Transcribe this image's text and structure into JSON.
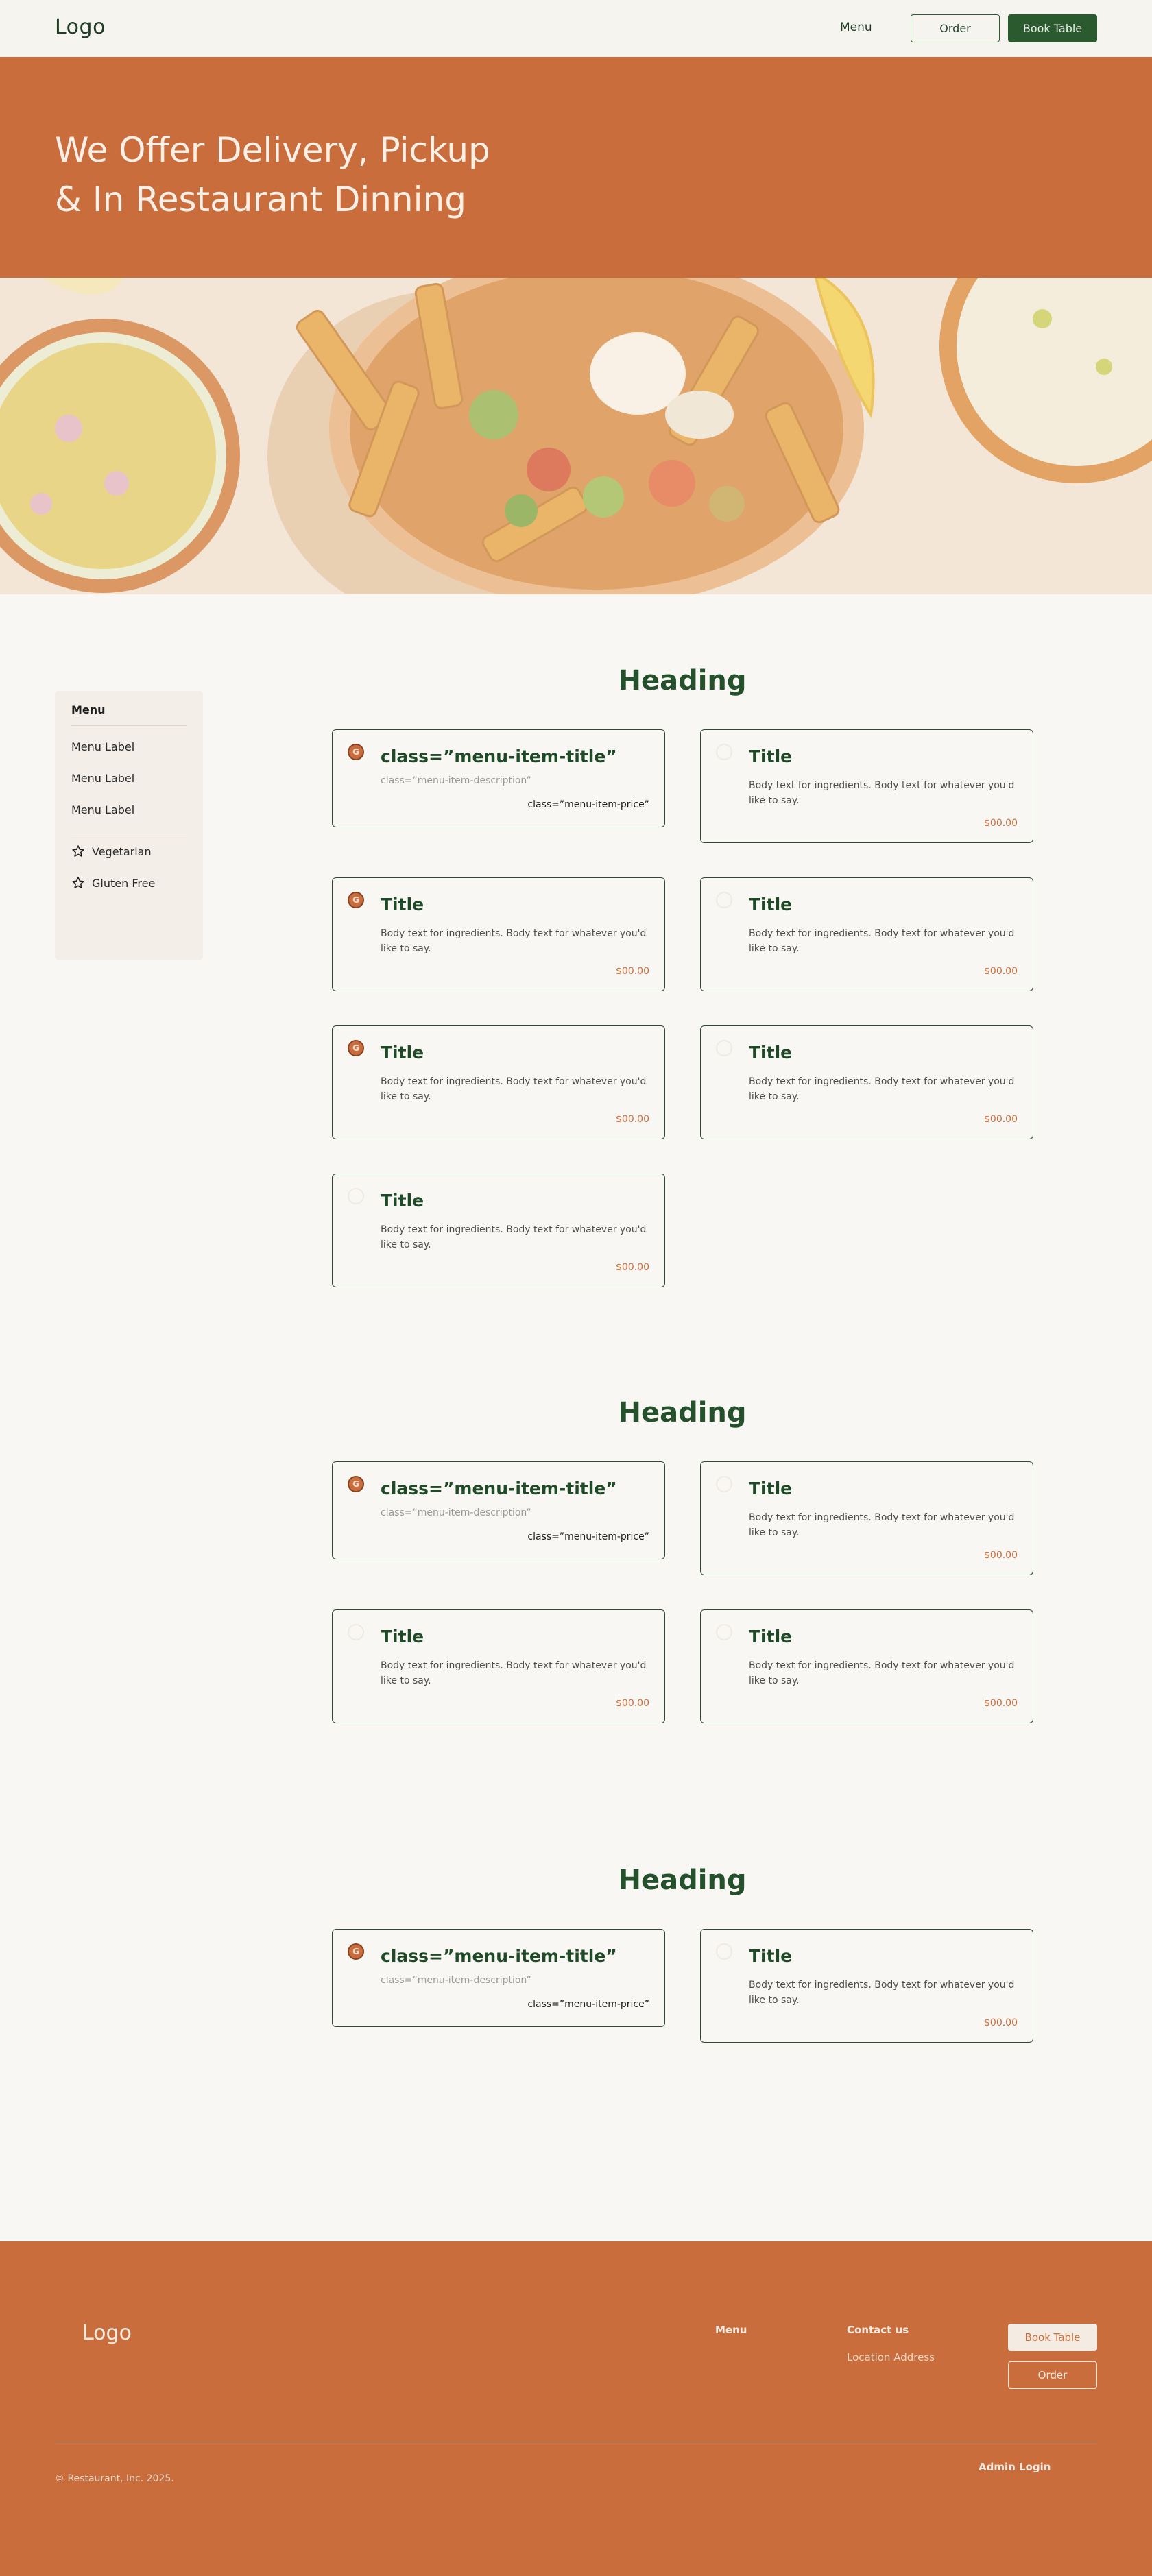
{
  "header": {
    "logo": "Logo",
    "nav_menu": "Menu",
    "order_label": "Order",
    "book_label": "Book Table"
  },
  "hero": {
    "line1": "We Offer Delivery, Pickup",
    "line2": "& In Restaurant Dinning"
  },
  "sidebar": {
    "title": "Menu",
    "items": [
      "Menu Label",
      "Menu Label",
      "Menu Label"
    ],
    "filters": [
      "Vegetarian",
      "Gluten Free"
    ]
  },
  "badge_letter": "G",
  "sections": [
    {
      "heading": "Heading",
      "cards": [
        {
          "title": "class=”menu-item-title”",
          "desc": "class=”menu-item-description”",
          "price": "class=”menu-item-price”",
          "badge": true,
          "template": true
        },
        {
          "title": "Title",
          "body": "Body text for ingredients. Body text for whatever you'd like to say.",
          "price": "$00.00",
          "badge": false
        },
        {
          "title": "Title",
          "body": "Body text for ingredients. Body text for whatever you'd like to say.",
          "price": "$00.00",
          "badge": true
        },
        {
          "title": "Title",
          "body": "Body text for ingredients. Body text for whatever you'd like to say.",
          "price": "$00.00",
          "badge": false
        },
        {
          "title": "Title",
          "body": "Body text for ingredients. Body text for whatever you'd like to say.",
          "price": "$00.00",
          "badge": true
        },
        {
          "title": "Title",
          "body": "Body text for ingredients. Body text for whatever you'd like to say.",
          "price": "$00.00",
          "badge": false
        },
        {
          "title": "Title",
          "body": "Body text for ingredients. Body text for whatever you'd like to say.",
          "price": "$00.00",
          "badge": false
        }
      ]
    },
    {
      "heading": "Heading",
      "cards": [
        {
          "title": "class=”menu-item-title”",
          "desc": "class=”menu-item-description”",
          "price": "class=”menu-item-price”",
          "badge": true,
          "template": true
        },
        {
          "title": "Title",
          "body": "Body text for ingredients. Body text for whatever you'd like to say.",
          "price": "$00.00",
          "badge": false
        },
        {
          "title": "Title",
          "body": "Body text for ingredients. Body text for whatever you'd like to say.",
          "price": "$00.00",
          "badge": false
        },
        {
          "title": "Title",
          "body": "Body text for ingredients. Body text for whatever you'd like to say.",
          "price": "$00.00",
          "badge": false
        }
      ]
    },
    {
      "heading": "Heading",
      "cards": [
        {
          "title": "class=”menu-item-title”",
          "desc": "class=”menu-item-description”",
          "price": "class=”menu-item-price”",
          "badge": true,
          "template": true
        },
        {
          "title": "Title",
          "body": "Body text for ingredients. Body text for whatever you'd like to say.",
          "price": "$00.00",
          "badge": false
        }
      ]
    }
  ],
  "footer": {
    "logo": "Logo",
    "menu": "Menu",
    "contact": "Contact us",
    "address": "Location Address",
    "book_label": "Book Table",
    "order_label": "Order",
    "copyright": "© Restaurant, Inc. 2025.",
    "admin": "Admin Login"
  },
  "colors": {
    "accent": "#c96d3c",
    "brand_green": "#2c5a2f",
    "background": "#f9f7f3"
  }
}
